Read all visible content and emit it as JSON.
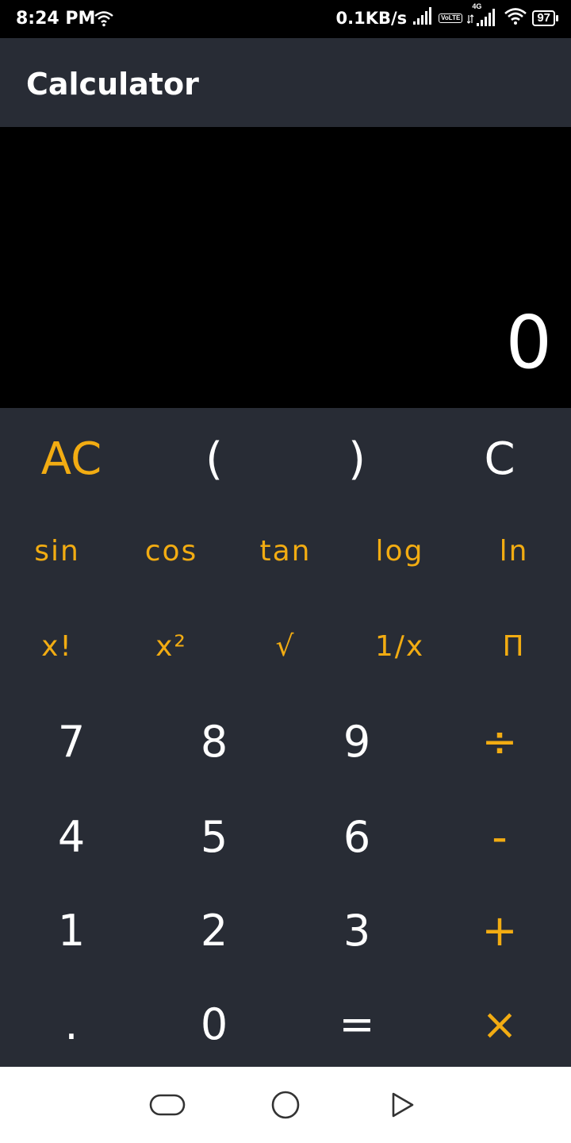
{
  "status_bar": {
    "time": "8:24 PM",
    "speed": "0.1KB/s",
    "volte_label": "VoLTE",
    "network_type": "4G",
    "battery_level": "97",
    "icons": [
      "wifi-icon",
      "signal-icon",
      "volte-icon",
      "signal-4g-icon",
      "battery-icon"
    ]
  },
  "app_bar": {
    "title": "Calculator"
  },
  "display": {
    "value": "0"
  },
  "keypad": {
    "row1": [
      "AC",
      "(",
      ")",
      "C"
    ],
    "row2": [
      "sin",
      "cos",
      "tan",
      "log",
      "ln"
    ],
    "row3": [
      "x!",
      "x²",
      "√",
      "1/x",
      "Π"
    ],
    "row4": [
      "7",
      "8",
      "9",
      "÷"
    ],
    "row5": [
      "4",
      "5",
      "6",
      "-"
    ],
    "row6": [
      "1",
      "2",
      "3",
      "+"
    ],
    "row7": [
      ".",
      "0",
      "=",
      "×"
    ]
  },
  "colors": {
    "accent": "#f2ac12",
    "background": "#282c35",
    "display": "#000000",
    "text": "#ffffff"
  },
  "nav_bar": {
    "icons": [
      "recent-apps-icon",
      "home-icon",
      "back-icon"
    ]
  }
}
